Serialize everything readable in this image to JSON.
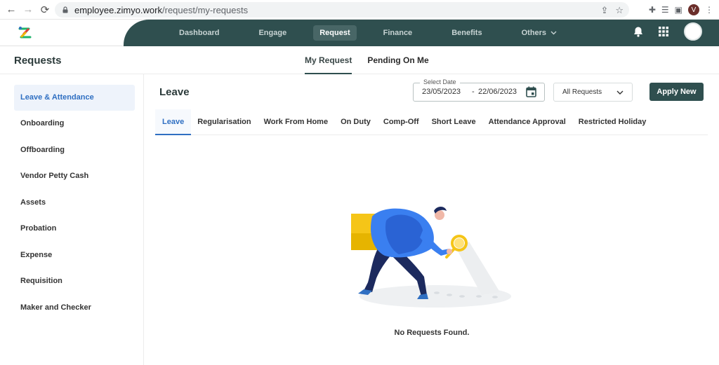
{
  "browser": {
    "url_host": "employee.zimyo.work",
    "url_path": "/request/my-requests",
    "avatar_letter": "V"
  },
  "topnav": {
    "items": [
      {
        "label": "Dashboard"
      },
      {
        "label": "Engage"
      },
      {
        "label": "Request",
        "active": true
      },
      {
        "label": "Finance"
      },
      {
        "label": "Benefits"
      },
      {
        "label": "Others"
      }
    ]
  },
  "subheader": {
    "title": "Requests",
    "tabs": [
      {
        "label": "My Request",
        "active": true
      },
      {
        "label": "Pending On Me"
      }
    ]
  },
  "sidebar": {
    "items": [
      {
        "label": "Leave & Attendance",
        "active": true
      },
      {
        "label": "Onboarding"
      },
      {
        "label": "Offboarding"
      },
      {
        "label": "Vendor Petty Cash"
      },
      {
        "label": "Assets"
      },
      {
        "label": "Probation"
      },
      {
        "label": "Expense"
      },
      {
        "label": "Requisition"
      },
      {
        "label": "Maker and Checker"
      }
    ]
  },
  "main": {
    "title": "Leave",
    "date_label": "Select Date",
    "date_from": "23/05/2023",
    "date_separator": "-",
    "date_to": "22/06/2023",
    "filter_value": "All Requests",
    "apply_label": "Apply New",
    "tabs": [
      {
        "label": "Leave",
        "active": true
      },
      {
        "label": "Regularisation"
      },
      {
        "label": "Work From Home"
      },
      {
        "label": "On Duty"
      },
      {
        "label": "Comp-Off"
      },
      {
        "label": "Short Leave"
      },
      {
        "label": "Attendance Approval"
      },
      {
        "label": "Restricted Holiday"
      }
    ],
    "empty_message": "No Requests Found."
  },
  "colors": {
    "brand_dark": "#2f4f4f",
    "accent_blue": "#2f6fc2"
  }
}
